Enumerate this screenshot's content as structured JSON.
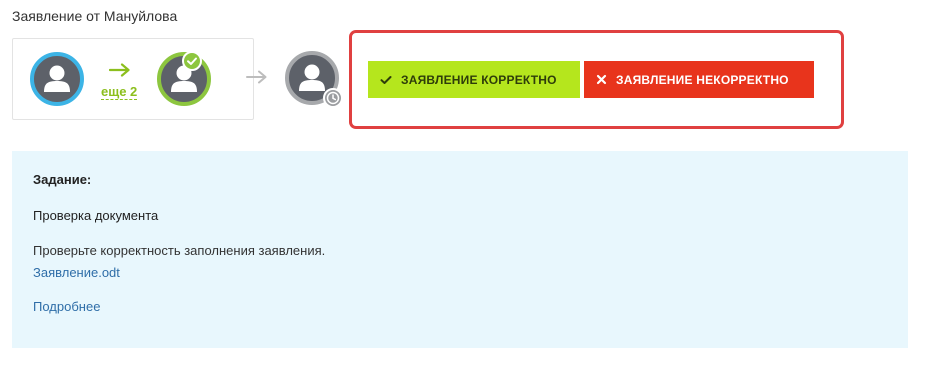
{
  "header": {
    "title": "Заявление от Мануйлова"
  },
  "workflow": {
    "more_label": "еще 2",
    "steps": [
      {
        "icon": "user-avatar-icon",
        "ring_color": "#3cb4e6",
        "status": "current"
      },
      {
        "icon": "user-avatar-icon",
        "ring_color": "#8dc63f",
        "status": "done",
        "badge": "check-icon"
      },
      {
        "icon": "user-avatar-icon",
        "ring_color": "#a7a9ac",
        "status": "pending",
        "badge": "clock-icon"
      }
    ],
    "colors": {
      "arrow_more": "#8cbf1e",
      "arrow_flow": "#bdbdbd"
    }
  },
  "actions": {
    "approve_label": "ЗАЯВЛЕНИЕ КОРРЕКТНО",
    "approve_icon": "check-icon",
    "approve_color": "#b5e61d",
    "reject_label": "ЗАЯВЛЕНИЕ НЕКОРРЕКТНО",
    "reject_icon": "close-icon",
    "reject_color": "#e8341c",
    "highlight_color": "#e04040"
  },
  "task": {
    "heading": "Задание:",
    "name": "Проверка документа",
    "description": "Проверьте корректность заполнения заявления.",
    "attachment_link": "Заявление.odt",
    "details_link": "Подробнее",
    "background": "#e8f7fd",
    "link_color": "#2f6ea8"
  }
}
